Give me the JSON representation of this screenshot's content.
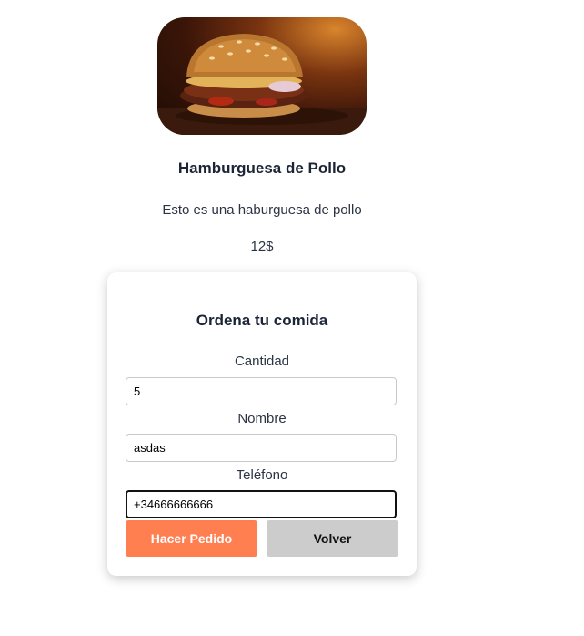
{
  "product": {
    "title": "Hamburguesa de Pollo",
    "description": "Esto es una haburguesa de pollo",
    "price": "12$"
  },
  "order_form": {
    "title": "Ordena tu comida",
    "fields": [
      {
        "label": "Cantidad",
        "value": "5"
      },
      {
        "label": "Nombre",
        "value": "asdas"
      },
      {
        "label": "Teléfono",
        "value": "+34666666666"
      }
    ],
    "submit_label": "Hacer Pedido",
    "back_label": "Volver"
  },
  "colors": {
    "submit_button": "#ff7f50",
    "back_button": "#cccccc"
  }
}
